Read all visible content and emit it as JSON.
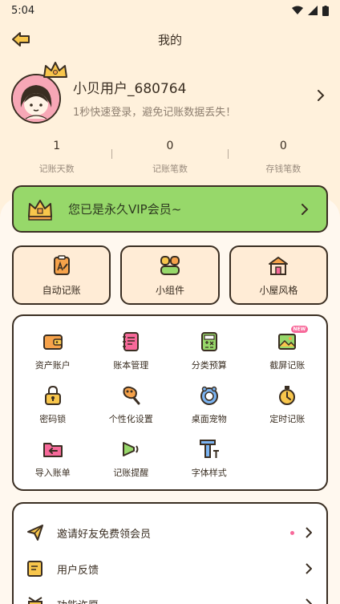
{
  "status_bar": {
    "time": "5:04"
  },
  "header": {
    "title": "我的"
  },
  "profile": {
    "username": "小贝用户_680764",
    "subtitle": "1秒快速登录，避免记账数据丢失！"
  },
  "stats": [
    {
      "value": "1",
      "label": "记账天数"
    },
    {
      "value": "0",
      "label": "记账笔数"
    },
    {
      "value": "0",
      "label": "存钱笔数"
    }
  ],
  "vip": {
    "text": "您已是永久VIP会员~"
  },
  "quick_actions": [
    {
      "label": "自动记账",
      "icon": "auto-bookkeeping-icon"
    },
    {
      "label": "小组件",
      "icon": "widget-icon"
    },
    {
      "label": "小屋风格",
      "icon": "house-style-icon"
    }
  ],
  "features": [
    {
      "label": "资产账户",
      "icon": "wallet-icon"
    },
    {
      "label": "账本管理",
      "icon": "notebook-icon"
    },
    {
      "label": "分类预算",
      "icon": "calculator-icon"
    },
    {
      "label": "截屏记账",
      "icon": "screenshot-icon",
      "badge": "NEW"
    },
    {
      "label": "密码锁",
      "icon": "lock-icon"
    },
    {
      "label": "个性化设置",
      "icon": "paint-icon"
    },
    {
      "label": "桌面宠物",
      "icon": "pet-icon"
    },
    {
      "label": "定时记账",
      "icon": "timer-icon"
    },
    {
      "label": "导入账单",
      "icon": "import-folder-icon"
    },
    {
      "label": "记账提醒",
      "icon": "megaphone-icon"
    },
    {
      "label": "字体样式",
      "icon": "font-icon"
    }
  ],
  "list": [
    {
      "label": "邀请好友免费领会员",
      "icon": "paper-plane-icon"
    },
    {
      "label": "用户反馈",
      "icon": "feedback-icon"
    },
    {
      "label": "功能许愿",
      "icon": "wish-icon"
    }
  ],
  "colors": {
    "background": "#FFF1DC",
    "vip_green": "#97D86A",
    "outline": "#3A2E22",
    "accent_orange": "#F6A24A",
    "badge_pink": "#F7699A"
  }
}
